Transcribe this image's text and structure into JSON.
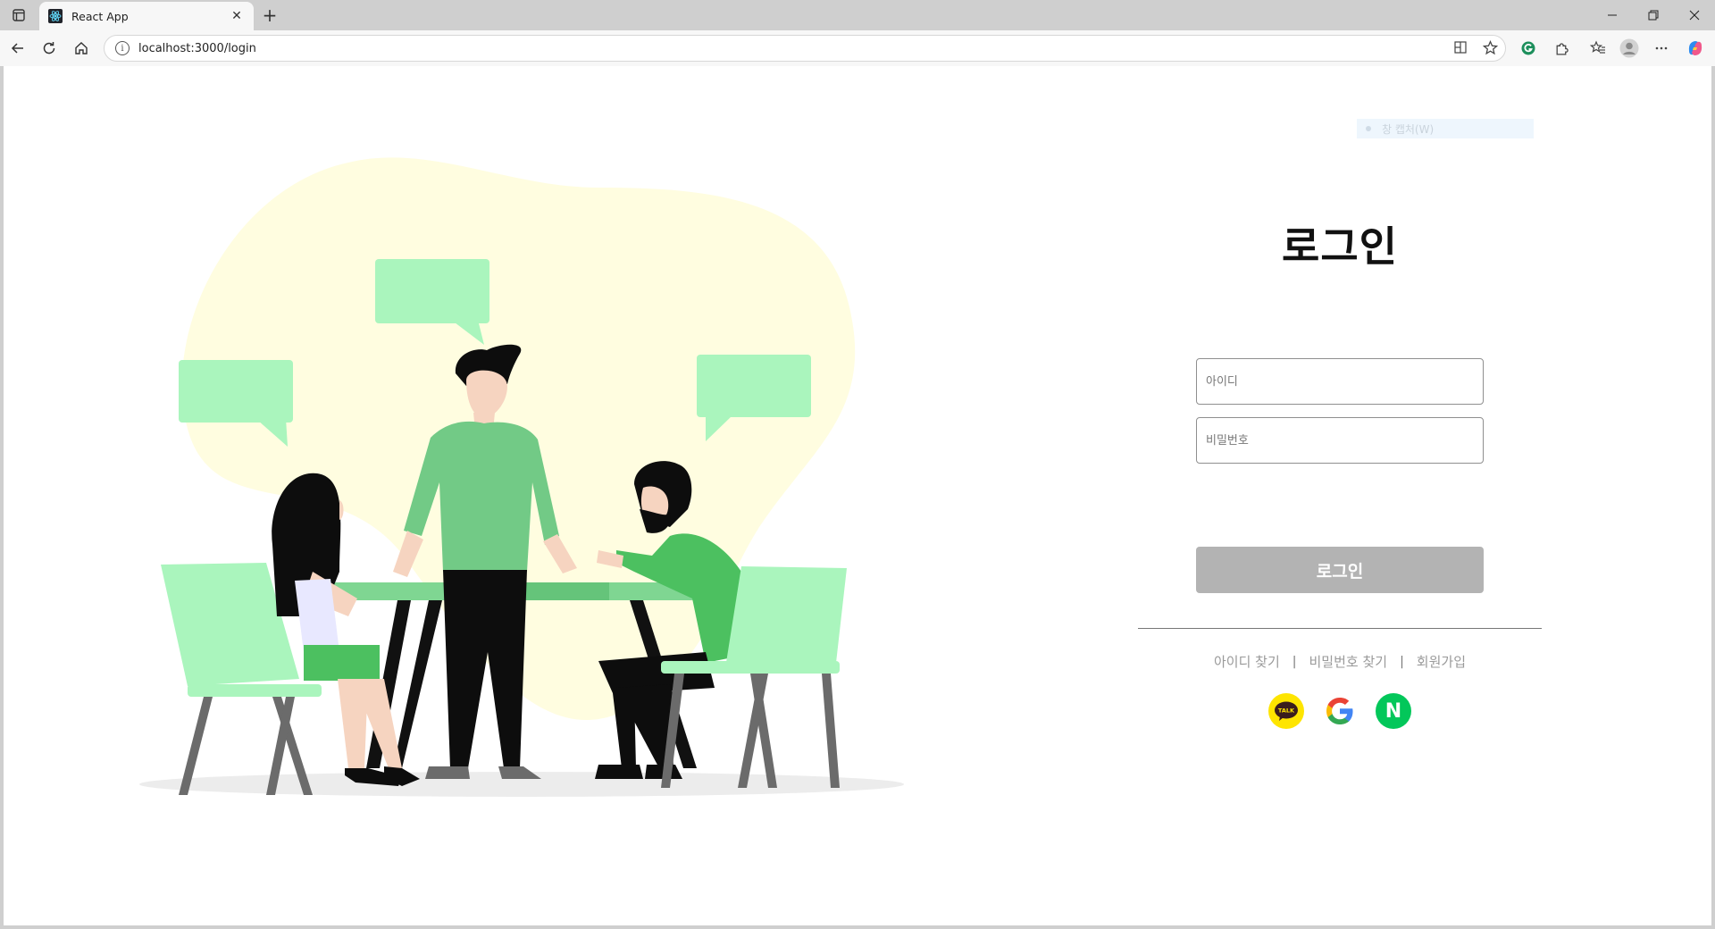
{
  "browser": {
    "tab_title": "React App",
    "url": "localhost:3000/login",
    "icons": {
      "tab_actions": "tab-actions-icon",
      "favicon": "react-logo-icon",
      "close_tab": "close-icon",
      "new_tab": "plus-icon",
      "back": "back-arrow-icon",
      "refresh": "refresh-icon",
      "home": "home-icon",
      "site_info": "info-icon",
      "reader": "immersive-reader-icon",
      "favorite": "star-icon",
      "extension_green": "extension-icon",
      "extensions": "puzzle-icon",
      "favorites": "favorites-icon",
      "profile": "profile-icon",
      "more": "more-icon",
      "copilot": "copilot-icon"
    }
  },
  "page": {
    "capture_hint": "창 캡처(W)",
    "title": "로그인",
    "id_placeholder": "아이디",
    "password_placeholder": "비밀번호",
    "login_button": "로그인",
    "links": {
      "find_id": "아이디 찾기",
      "find_password": "비밀번호 찾기",
      "signup": "회원가입",
      "separator": "|"
    },
    "social": {
      "kakao_label": "TALK",
      "naver_label": "N"
    },
    "colors": {
      "accent_green": "#4cc060",
      "button_disabled": "#b3b3b3",
      "kakao": "#fee500",
      "naver": "#03c75a"
    }
  }
}
